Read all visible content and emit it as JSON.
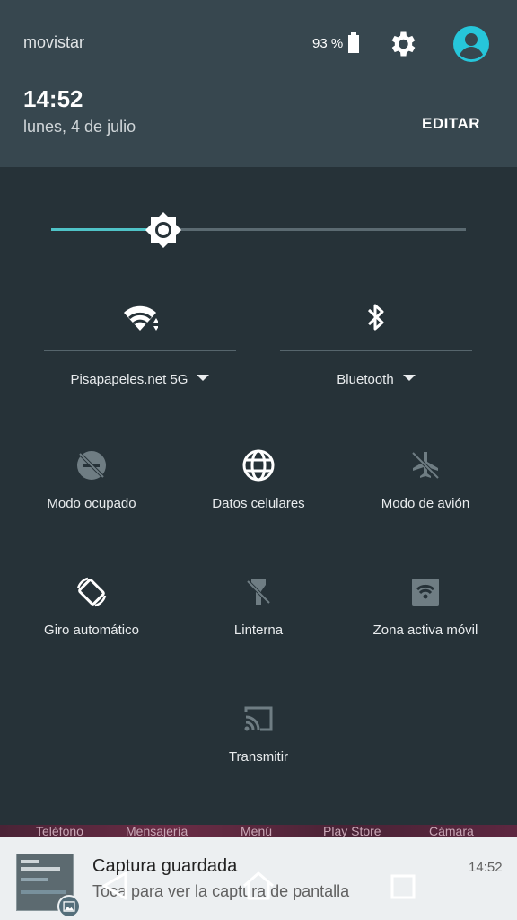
{
  "status_bar": {
    "carrier": "movistar",
    "battery_percent": "93 %",
    "icons": [
      "battery-icon",
      "settings-icon",
      "user-account-icon"
    ]
  },
  "header": {
    "time": "14:52",
    "date": "lunes, 4 de julio",
    "edit_label": "EDITAR"
  },
  "brightness": {
    "level": 0.27,
    "icon": "brightness-icon"
  },
  "big_tiles": [
    {
      "label": "Pisapapeles.net 5G",
      "icon": "wifi-icon"
    },
    {
      "label": "Bluetooth",
      "icon": "bluetooth-icon"
    }
  ],
  "tiles": [
    {
      "label": "Modo ocupado",
      "icon": "do-not-disturb-off-icon"
    },
    {
      "label": "Datos celulares",
      "icon": "globe-icon"
    },
    {
      "label": "Modo de avión",
      "icon": "airplane-icon"
    },
    {
      "label": "Giro automático",
      "icon": "auto-rotate-icon"
    },
    {
      "label": "Linterna",
      "icon": "flashlight-off-icon"
    },
    {
      "label": "Zona activa móvil",
      "icon": "hotspot-icon"
    },
    {
      "label": "Transmitir",
      "icon": "cast-icon"
    }
  ],
  "app_row": [
    "Teléfono",
    "Mensajería",
    "Menú",
    "Play Store",
    "Cámara"
  ],
  "notification": {
    "title": "Captura guardada",
    "text": "Toca para ver la captura de pantalla",
    "time": "14:52",
    "icon": "image-icon"
  },
  "nav_bar": [
    "back-icon",
    "home-icon",
    "recents-icon"
  ],
  "colors": {
    "panel_bg": "#263238",
    "header_bg": "#37474f",
    "accent": "#4fc3c7",
    "notification_bg": "#eceff1"
  }
}
